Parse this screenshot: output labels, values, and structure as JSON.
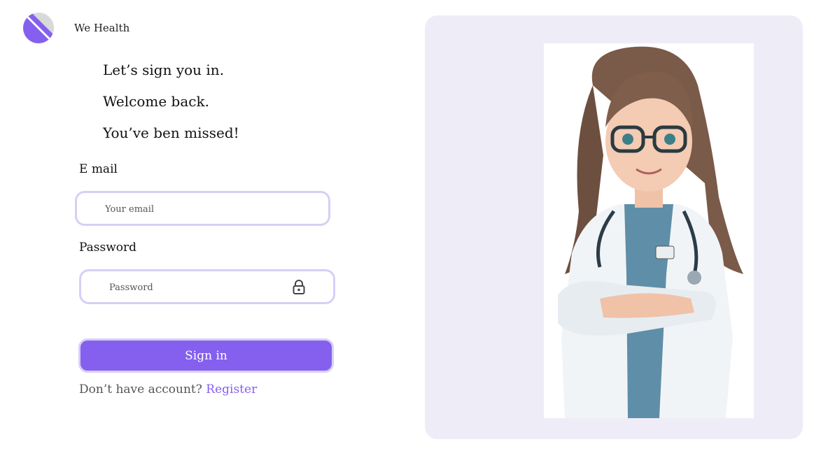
{
  "brand": {
    "name": "We Health",
    "logo_icon": "half-circle-logo-icon",
    "accent": "#8560ef"
  },
  "welcome": {
    "line1": "Let’s sign you in.",
    "line2": "Welcome back.",
    "line3": "You’ve ben missed!"
  },
  "form": {
    "email_label": "E mail",
    "email_placeholder": "Your email",
    "email_value": "",
    "password_label": "Password",
    "password_placeholder": "Password",
    "password_value": "",
    "password_icon": "lock-icon",
    "submit_label": "Sign in"
  },
  "register": {
    "prompt": "Don’t have account?",
    "link_label": "Register"
  },
  "hero": {
    "image": "doctor-illustration"
  },
  "colors": {
    "accent": "#8560ef",
    "input_border": "#d6cff7",
    "panel_bg": "#eeedf7"
  }
}
